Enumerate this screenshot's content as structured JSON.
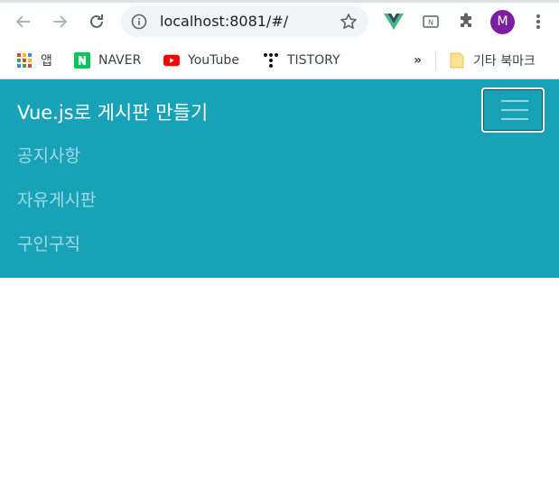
{
  "browser": {
    "url": "localhost:8081/#/",
    "avatar_letter": "M",
    "bookmarks": [
      {
        "label": "앱",
        "icon": "apps-grid-icon"
      },
      {
        "label": "NAVER",
        "icon": "naver-icon"
      },
      {
        "label": "YouTube",
        "icon": "youtube-icon"
      },
      {
        "label": "TISTORY",
        "icon": "tistory-icon"
      }
    ],
    "overflow_label": "»",
    "other_bookmarks": "기타 북마크"
  },
  "app": {
    "brand": "Vue.js로 게시판 만들기",
    "nav_items": [
      "공지사항",
      "자유게시판",
      "구인구직"
    ],
    "colors": {
      "navbar": "#17a2b8",
      "brand_text": "#ffffff"
    }
  }
}
